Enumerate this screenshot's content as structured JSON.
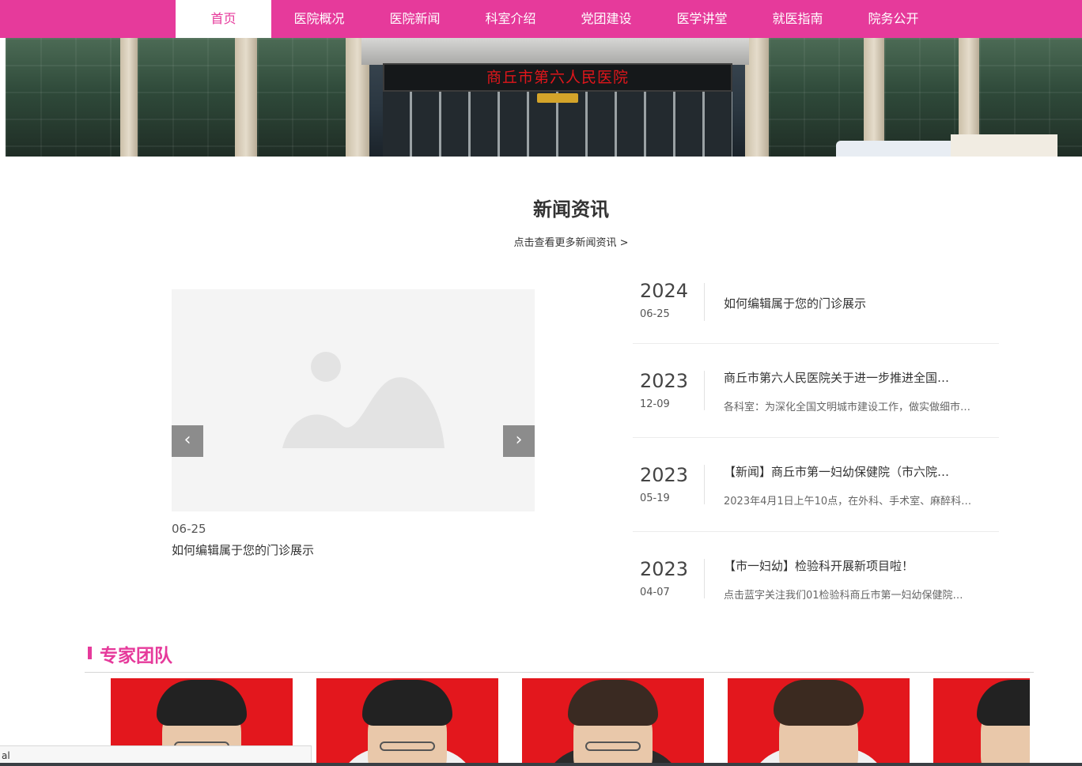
{
  "nav": {
    "items": [
      {
        "label": "首页",
        "active": true
      },
      {
        "label": "医院概况"
      },
      {
        "label": "医院新闻"
      },
      {
        "label": "科室介绍"
      },
      {
        "label": "党团建设"
      },
      {
        "label": "医学讲堂"
      },
      {
        "label": "就医指南"
      },
      {
        "label": "院务公开"
      }
    ],
    "accent_color": "#e63a9b"
  },
  "banner": {
    "sign_text": "商丘市第六人民医院"
  },
  "news": {
    "title": "新闻资讯",
    "more_link": "点击查看更多新闻资讯 >",
    "slider": {
      "date": "06-25",
      "title": "如何编辑属于您的门诊展示",
      "prev_icon": "‹",
      "next_icon": "›"
    },
    "items": [
      {
        "year": "2024",
        "md": "06-25",
        "title": "如何编辑属于您的门诊展示",
        "summary": ""
      },
      {
        "year": "2023",
        "md": "12-09",
        "title": "商丘市第六人民医院关于进一步推进全国…",
        "summary": "各科室：为深化全国文明城市建设工作，做实做细市…"
      },
      {
        "year": "2023",
        "md": "05-19",
        "title": "【新闻】商丘市第一妇幼保健院（市六院…",
        "summary": "2023年4月1日上午10点，在外科、手术室、麻醉科…"
      },
      {
        "year": "2023",
        "md": "04-07",
        "title": "【市一妇幼】检验科开展新项目啦！",
        "summary": "点击蓝字关注我们01检验科商丘市第一妇幼保健院…"
      }
    ]
  },
  "team": {
    "title": "专家团队"
  },
  "status_tip": {
    "text": "al"
  }
}
